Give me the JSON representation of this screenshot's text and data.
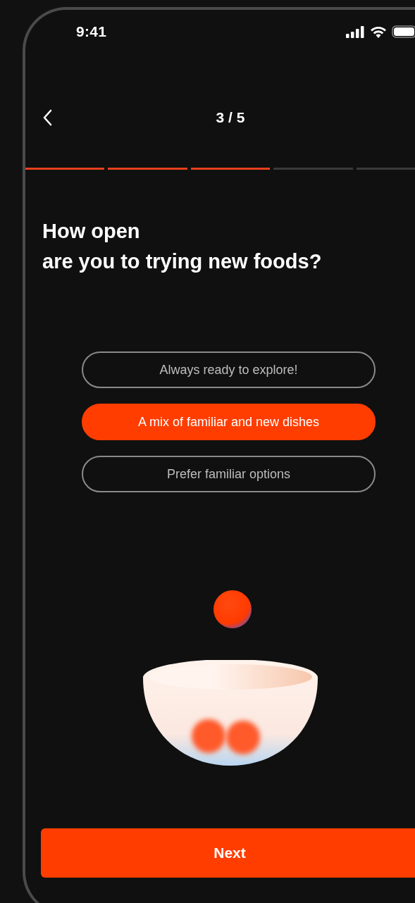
{
  "status_bar": {
    "time": "9:41"
  },
  "header": {
    "step": "3 / 5"
  },
  "progress": {
    "steps": [
      {
        "done": true
      },
      {
        "done": true
      },
      {
        "done": true
      },
      {
        "done": false
      },
      {
        "done": false
      }
    ]
  },
  "question": {
    "text": "How open\nare you to trying new foods?"
  },
  "options": [
    {
      "label": "Always ready to explore!",
      "selected": false
    },
    {
      "label": "A mix of familiar and new dishes",
      "selected": true
    },
    {
      "label": "Prefer familiar options",
      "selected": false
    }
  ],
  "next_button": {
    "label": "Next"
  }
}
